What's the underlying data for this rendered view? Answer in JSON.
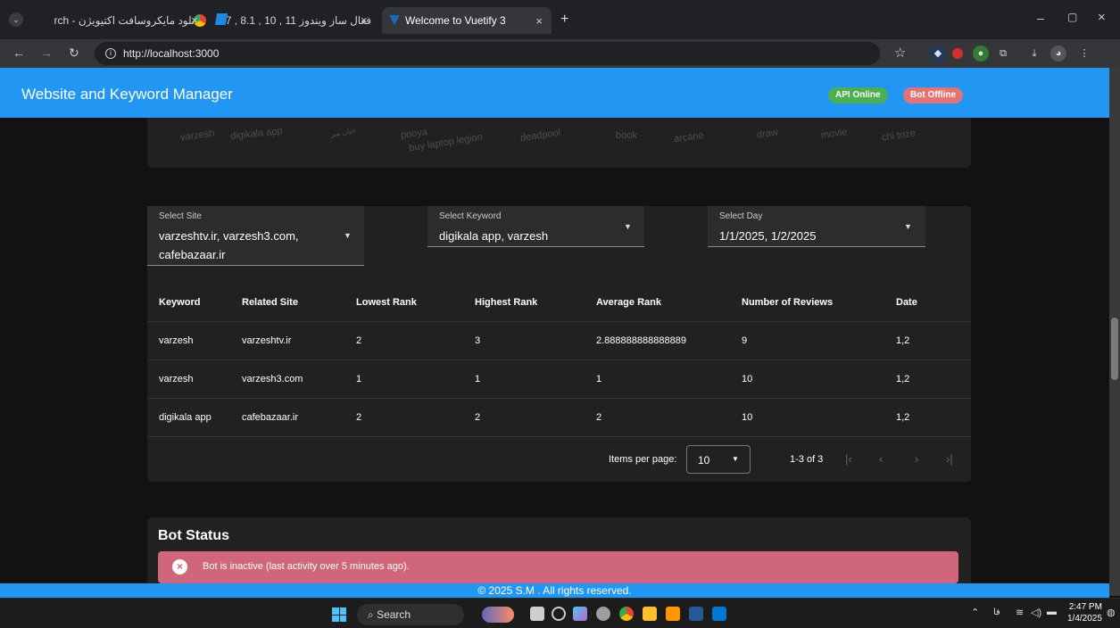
{
  "browser": {
    "tabs": [
      {
        "label": "دانلود مایکروسافت اکتیویژن - rch",
        "close": "×"
      },
      {
        "label": "فعال ساز ویندوز 11 , 10 , 8.1 , 7",
        "close": "×"
      },
      {
        "label": "Welcome to Vuetify 3",
        "close": "×"
      }
    ],
    "new_tab": "+",
    "url": "http://localhost:3000",
    "window_controls": [
      "–",
      "▢",
      "×"
    ]
  },
  "app": {
    "title": "Website and Keyword Manager",
    "api_status": "API Online",
    "bot_status": "Bot Offline",
    "colors": {
      "primary": "#2196f3",
      "success": "#4caf50",
      "error": "#cf6679"
    }
  },
  "word_cloud": [
    "varzesh",
    "digikala app",
    "خبان مبر",
    "pooya",
    "buy laptop legion",
    "deadpool",
    "book",
    "arcane",
    "draw",
    "movie",
    "chi toze"
  ],
  "filters": {
    "site": {
      "label": "Select Site",
      "value_line1": "varzeshtv.ir, varzesh3.com,",
      "value_line2": "cafebazaar.ir"
    },
    "keyword": {
      "label": "Select Keyword",
      "value": "digikala app, varzesh"
    },
    "day": {
      "label": "Select Day",
      "value": "1/1/2025, 1/2/2025"
    }
  },
  "table": {
    "headers": [
      "Keyword",
      "Related Site",
      "Lowest Rank",
      "Highest Rank",
      "Average Rank",
      "Number of Reviews",
      "Date"
    ],
    "rows": [
      [
        "varzesh",
        "varzeshtv.ir",
        "2",
        "3",
        "2.888888888888889",
        "9",
        "1,2"
      ],
      [
        "varzesh",
        "varzesh3.com",
        "1",
        "1",
        "1",
        "10",
        "1,2"
      ],
      [
        "digikala app",
        "cafebazaar.ir",
        "2",
        "2",
        "2",
        "10",
        "1,2"
      ]
    ]
  },
  "pagination": {
    "items_per_page_label": "Items per page:",
    "items_per_page": "10",
    "range": "1-3 of 3"
  },
  "bot_card": {
    "title": "Bot Status",
    "alert": "Bot is inactive (last activity over 5 minutes ago)."
  },
  "footer": "© 2025 S.M . All rights reserved.",
  "taskbar": {
    "search": "Search",
    "time": "2:47 PM",
    "date": "1/4/2025",
    "lang": "فا"
  }
}
